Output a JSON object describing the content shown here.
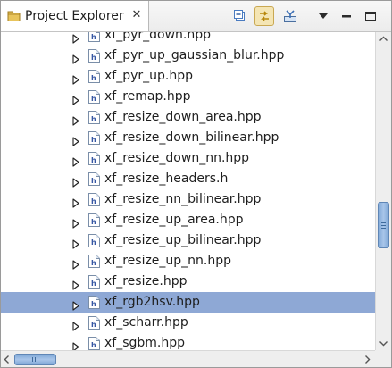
{
  "view": {
    "title": "Project Explorer",
    "close_glyph": "✕",
    "icon": "project-explorer-icon"
  },
  "toolbar": {
    "buttons": [
      {
        "name": "collapse-all-button",
        "icon": "collapse-all-icon",
        "active": false
      },
      {
        "name": "link-with-editor-button",
        "icon": "link-with-editor-icon",
        "active": true
      },
      {
        "name": "focus-on-active-task-button",
        "icon": "focus-task-icon",
        "active": false
      },
      {
        "name": "view-menu-button",
        "icon": "chevron-down-icon",
        "active": false
      },
      {
        "name": "minimize-button",
        "icon": "minimize-icon",
        "active": false
      },
      {
        "name": "maximize-button",
        "icon": "maximize-icon",
        "active": false
      }
    ]
  },
  "tree": {
    "selected_index": 13,
    "items": [
      {
        "label": "xf_pyr_down.hpp"
      },
      {
        "label": "xf_pyr_up_gaussian_blur.hpp"
      },
      {
        "label": "xf_pyr_up.hpp"
      },
      {
        "label": "xf_remap.hpp"
      },
      {
        "label": "xf_resize_down_area.hpp"
      },
      {
        "label": "xf_resize_down_bilinear.hpp"
      },
      {
        "label": "xf_resize_down_nn.hpp"
      },
      {
        "label": "xf_resize_headers.h"
      },
      {
        "label": "xf_resize_nn_bilinear.hpp"
      },
      {
        "label": "xf_resize_up_area.hpp"
      },
      {
        "label": "xf_resize_up_bilinear.hpp"
      },
      {
        "label": "xf_resize_up_nn.hpp"
      },
      {
        "label": "xf_resize.hpp"
      },
      {
        "label": "xf_rgb2hsv.hpp"
      },
      {
        "label": "xf_scharr.hpp"
      },
      {
        "label": "xf_sgbm.hpp"
      }
    ]
  },
  "scrollbars": {
    "vertical_position": 0.64,
    "vertical_visible_fraction": 0.16,
    "horizontal_position": 0.0,
    "horizontal_visible_fraction": 0.12
  },
  "colors": {
    "selection": "#8ea8d5",
    "scroll_thumb": "#8fb2dd",
    "active_toolbar_button": "#f4e5b4"
  }
}
